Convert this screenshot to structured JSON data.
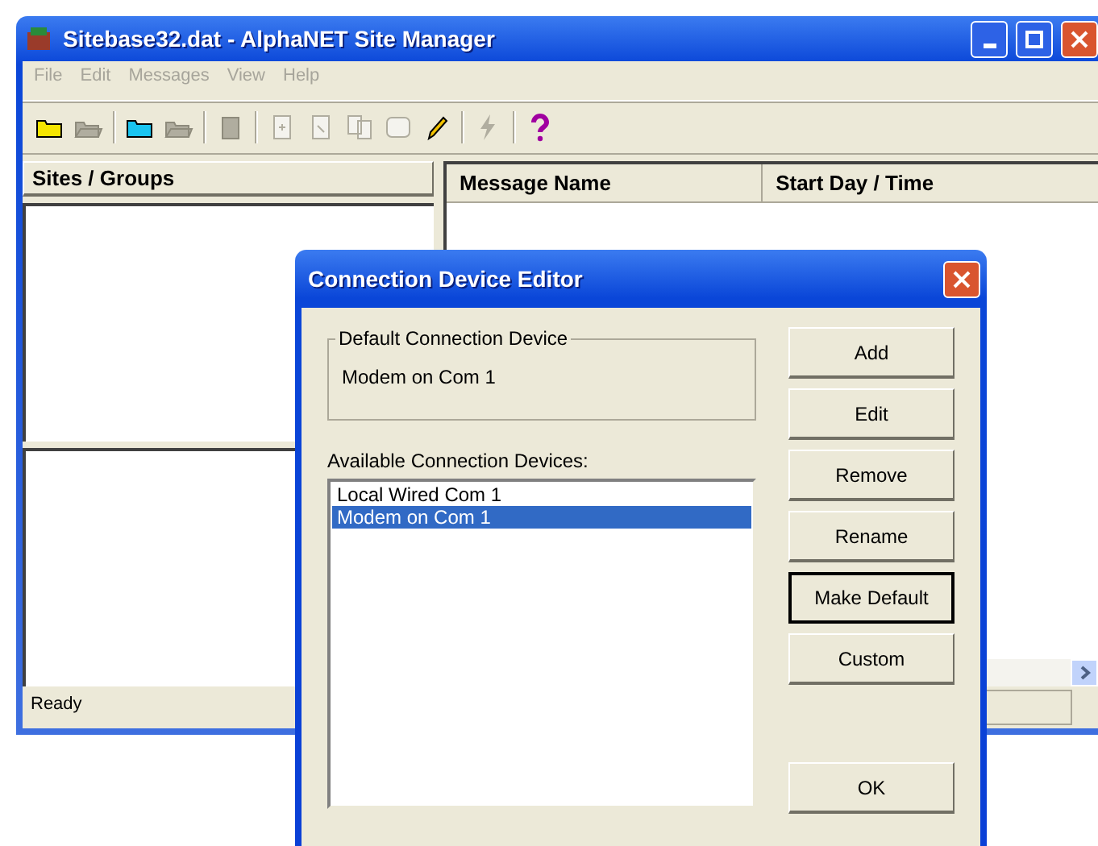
{
  "window": {
    "title": "Sitebase32.dat - AlphaNET Site Manager"
  },
  "menu": [
    {
      "label": "File",
      "disabled": true
    },
    {
      "label": "Edit",
      "disabled": true
    },
    {
      "label": "Messages",
      "disabled": true
    },
    {
      "label": "View",
      "disabled": true
    },
    {
      "label": "Help",
      "disabled": true
    }
  ],
  "toolbar": [
    {
      "kind": "folder",
      "disabled": false
    },
    {
      "kind": "folder-open",
      "disabled": true
    },
    {
      "kind": "separator"
    },
    {
      "kind": "folder-cyan",
      "disabled": false
    },
    {
      "kind": "folder-open",
      "disabled": true
    },
    {
      "kind": "separator"
    },
    {
      "kind": "trash",
      "disabled": true
    },
    {
      "kind": "separator"
    },
    {
      "kind": "page-plus",
      "disabled": true
    },
    {
      "kind": "page",
      "disabled": true
    },
    {
      "kind": "copy",
      "disabled": true
    },
    {
      "kind": "frame",
      "disabled": true
    },
    {
      "kind": "pencil",
      "disabled": false
    },
    {
      "kind": "separator"
    },
    {
      "kind": "bolt",
      "disabled": true
    },
    {
      "kind": "separator"
    },
    {
      "kind": "help",
      "disabled": false
    }
  ],
  "sites_panel": {
    "header": "Sites / Groups"
  },
  "messages_table": {
    "columns": [
      "Message Name",
      "Start Day / Time"
    ]
  },
  "status_bar": {
    "text": "Ready"
  },
  "dialog": {
    "title": "Connection Device Editor",
    "default_group": {
      "legend": "Default Connection Device",
      "value": "Modem on Com 1"
    },
    "list_label": "Available Connection Devices:",
    "devices": [
      {
        "label": "Local Wired Com 1",
        "selected": false
      },
      {
        "label": "Modem on Com 1",
        "selected": true
      }
    ],
    "buttons": [
      {
        "label": "Add",
        "focused": false
      },
      {
        "label": "Edit",
        "focused": false
      },
      {
        "label": "Remove",
        "focused": false
      },
      {
        "label": "Rename",
        "focused": false
      },
      {
        "label": "Make Default",
        "focused": true
      },
      {
        "label": "Custom",
        "focused": false
      }
    ],
    "ok_button": "OK"
  }
}
